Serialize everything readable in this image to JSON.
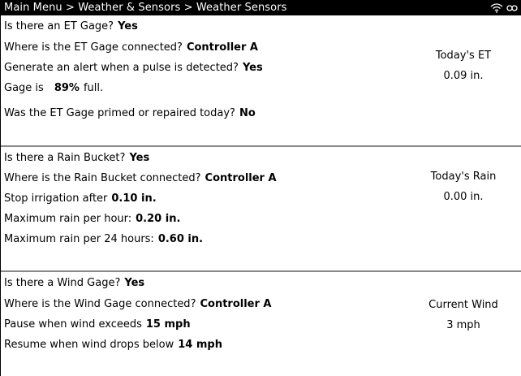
{
  "header": {
    "breadcrumb": "Main Menu > Weather & Sensors > Weather Sensors",
    "icons": [
      "wifi-icon",
      "link-icon"
    ]
  },
  "et": {
    "q1_label": "Is there an ET Gage?",
    "q1_value": "Yes",
    "q2_label": "Where is the ET Gage connected?",
    "q2_value": "Controller A",
    "q3_label": "Generate an alert when a pulse is detected?",
    "q3_value": "Yes",
    "q4_label": "Gage is",
    "q4_value": "89%",
    "q4_suffix": "full.",
    "q5_label": "Was the ET Gage primed or repaired today?",
    "q5_value": "No",
    "side_title": "Today's ET",
    "side_value": "0.09 in."
  },
  "rain": {
    "q1_label": "Is there a Rain Bucket?",
    "q1_value": "Yes",
    "q2_label": "Where is the Rain Bucket connected?",
    "q2_value": "Controller A",
    "q3_label": "Stop irrigation after",
    "q3_value": "0.10 in.",
    "q4_label": "Maximum rain per hour:",
    "q4_value": "0.20 in.",
    "q5_label": "Maximum rain per 24 hours:",
    "q5_value": "0.60 in.",
    "side_title": "Today's Rain",
    "side_value": "0.00 in."
  },
  "wind": {
    "q1_label": "Is there a Wind Gage?",
    "q1_value": "Yes",
    "q2_label": "Where is the Wind Gage connected?",
    "q2_value": "Controller A",
    "q3_label": "Pause when wind exceeds",
    "q3_value": "15 mph",
    "q4_label": "Resume when wind drops below",
    "q4_value": "14 mph",
    "side_title": "Current Wind",
    "side_value": "3 mph"
  }
}
